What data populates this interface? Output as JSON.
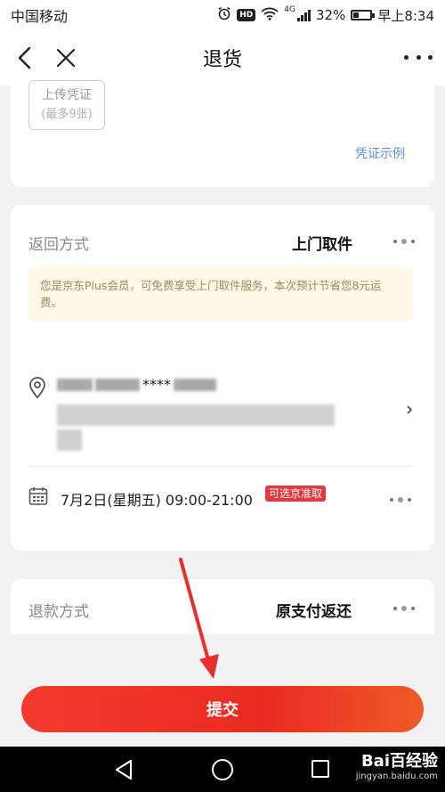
{
  "status_bar": {
    "carrier": "中国移动",
    "battery_percent": "32%",
    "battery_level": 0.32,
    "time": "早上8:34",
    "hd_label": "HD",
    "network_label": "4G",
    "icons": [
      "alarm-icon",
      "hd-icon",
      "wifi-icon",
      "signal-icon",
      "battery-icon"
    ]
  },
  "nav": {
    "title": "退货",
    "back_icon": "chevron-left-icon",
    "close_icon": "close-icon",
    "more_icon": "more-dots-icon"
  },
  "upload": {
    "label": "上传凭证",
    "sub_label": "(最多9张)",
    "example_link": "凭证示例"
  },
  "return_method": {
    "label": "返回方式",
    "value": "上门取件",
    "notice": "您是京东Plus会员，可免费享受上门取件服务，本次预计节省您8元运费。",
    "address_masked": "****",
    "time_slot": "7月2日(星期五) 09:00-21:00",
    "time_badge": "可选京准取"
  },
  "refund_method": {
    "label": "退款方式",
    "value": "原支付返还"
  },
  "submit": {
    "label": "提交"
  },
  "watermark": {
    "brand": "Bai百经验",
    "url": "jingyan.baidu.com"
  },
  "colors": {
    "accent_red": "#e4393c",
    "link_blue": "#5b8fd0",
    "notice_bg": "#fff8e6"
  }
}
